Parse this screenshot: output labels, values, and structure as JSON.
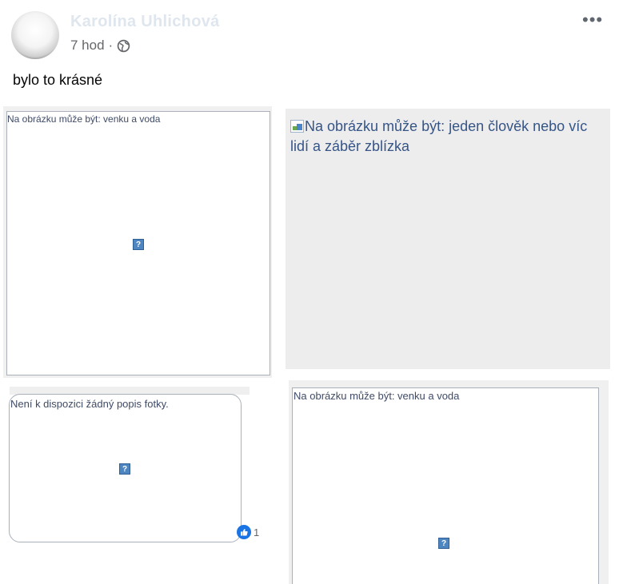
{
  "post": {
    "author": "Karolína Uhlichová",
    "time": "7 hod",
    "separator": "·",
    "text": "bylo to krásné",
    "more_label": "•••"
  },
  "photos": [
    {
      "alt": "Na obrázku může být: venku a voda"
    },
    {
      "alt": "Na obrázku může být: jeden člověk nebo víc lidí a záběr zblízka"
    },
    {
      "alt": "Není k dispozici žádný popis fotky."
    },
    {
      "alt": "Na obrázku může být: venku a voda"
    }
  ],
  "broken_image_glyph": "?",
  "reactions": {
    "count": "1"
  },
  "icons": {
    "avatar": "avatar",
    "audience": "globe-icon",
    "menu": "more-options-icon",
    "reaction": "like-icon"
  },
  "colors": {
    "link": "#365587",
    "meta": "#65676b",
    "reaction_blue": "#1b74e4"
  }
}
